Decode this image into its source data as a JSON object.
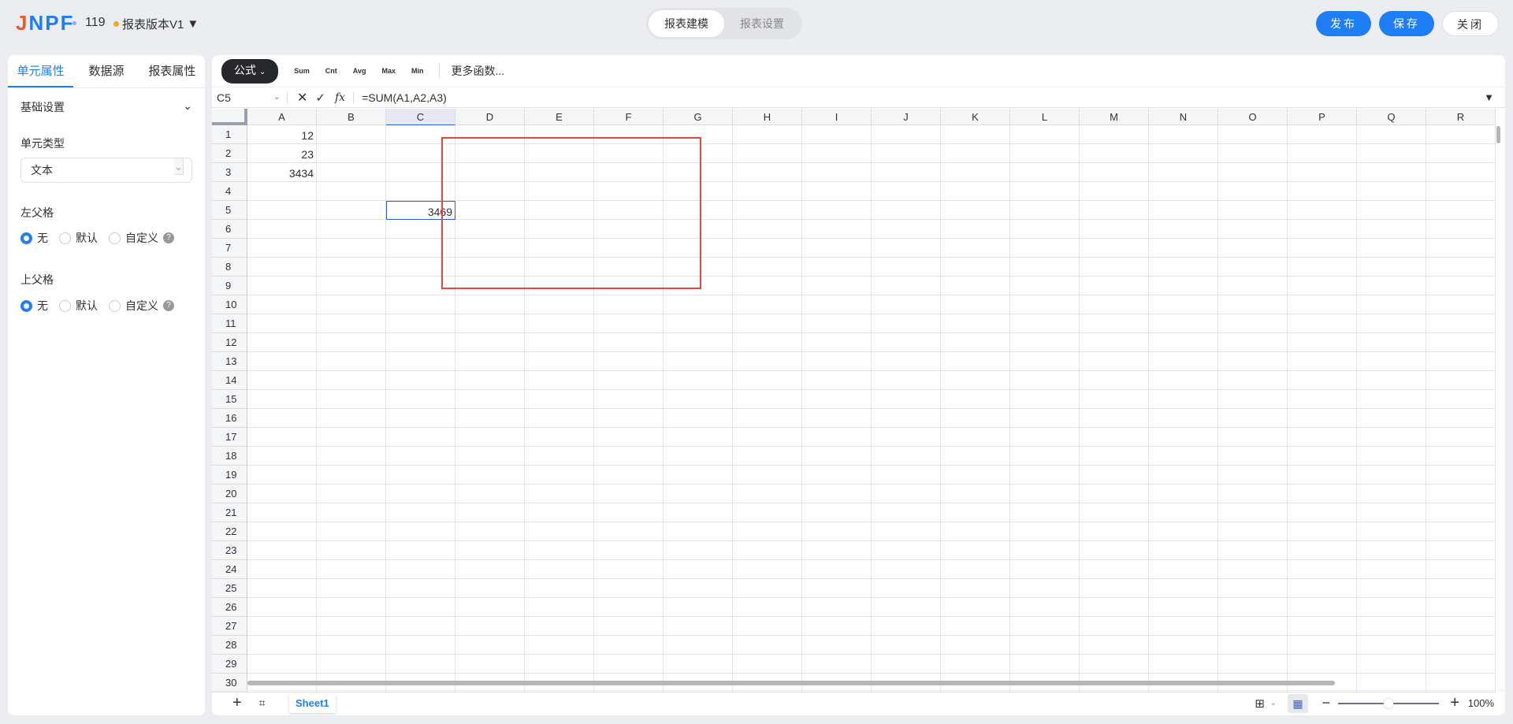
{
  "header": {
    "logo": "JNPF",
    "version_num": "119",
    "version_name": "报表版本V1",
    "tabs": [
      "报表建模",
      "报表设置"
    ],
    "publish": "发布",
    "save": "保存",
    "close": "关闭"
  },
  "left": {
    "tabs": [
      "单元属性",
      "数据源",
      "报表属性"
    ],
    "section": "基础设置",
    "cell_type_label": "单元类型",
    "cell_type_value": "文本",
    "left_parent_label": "左父格",
    "top_parent_label": "上父格",
    "options": [
      "无",
      "默认",
      "自定义"
    ],
    "help": "?"
  },
  "toolbar": {
    "formula": "公式",
    "funcs": [
      "Sum",
      "Cnt",
      "Avg",
      "Max",
      "Min"
    ],
    "more": "更多函数..."
  },
  "formula_bar": {
    "cell_ref": "C5",
    "formula": "=SUM(A1,A2,A3)",
    "fx": "fx"
  },
  "columns": [
    "A",
    "B",
    "C",
    "D",
    "E",
    "F",
    "G",
    "H",
    "I",
    "J",
    "K",
    "L",
    "M",
    "N",
    "O",
    "P",
    "Q",
    "R"
  ],
  "rows": 30,
  "cells": {
    "A1": "12",
    "A2": "23",
    "A3": "3434",
    "C5": "3469"
  },
  "bottom": {
    "sheet": "Sheet1",
    "zoom": "100%",
    "zoom_fraction": 0.5
  }
}
